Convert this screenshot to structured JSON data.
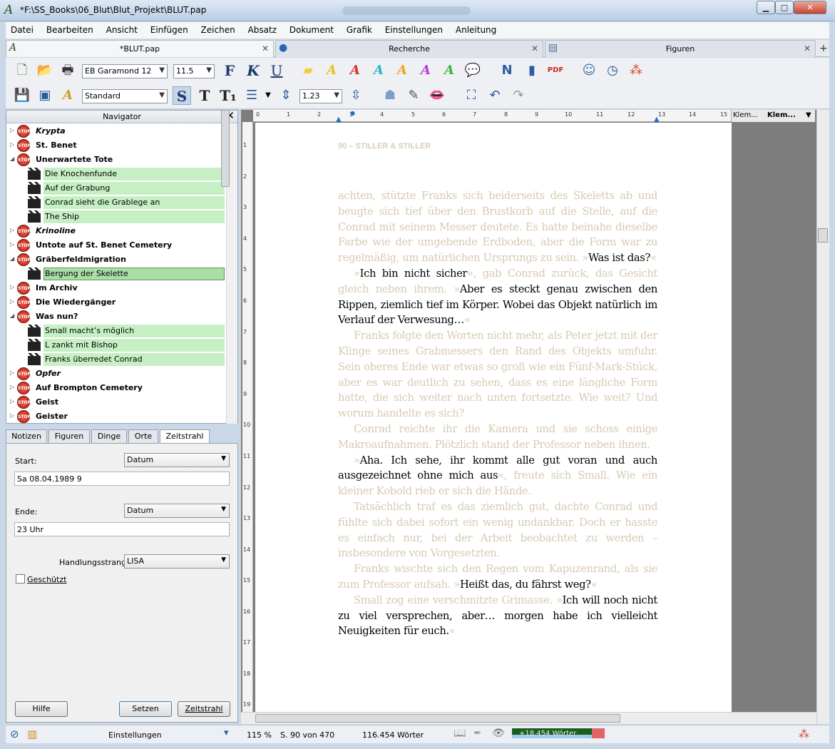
{
  "window": {
    "title": "*F:\\SS_Books\\06_Blut\\Blut_Projekt\\BLUT.pap",
    "buttons": {
      "minimize": "▁",
      "maximize": "□",
      "close": "✕"
    }
  },
  "menu": [
    "Datei",
    "Bearbeiten",
    "Ansicht",
    "Einfügen",
    "Zeichen",
    "Absatz",
    "Dokument",
    "Grafik",
    "Einstellungen",
    "Anleitung"
  ],
  "tabs": [
    {
      "label": "*BLUT.pap"
    },
    {
      "label": "Recherche"
    },
    {
      "label": "Figuren"
    }
  ],
  "toolbar": {
    "font": "EB Garamond 12",
    "size": "11.5",
    "style": "Standard",
    "line_spacing": "1.23",
    "bold": "F",
    "italic": "K",
    "underline": "U",
    "s_btn": "S",
    "t_btn": "T",
    "t1_btn": "T₁"
  },
  "navigator": {
    "title": "Navigator",
    "items": [
      {
        "label": "Krypta",
        "type": "chapter",
        "italic": true,
        "exp": "▷"
      },
      {
        "label": "St. Benet",
        "type": "chapter",
        "exp": "▷"
      },
      {
        "label": "Unerwartete Tote",
        "type": "chapter",
        "exp": "◢"
      },
      {
        "label": "Die Knochenfunde",
        "type": "scene"
      },
      {
        "label": "Auf der Grabung",
        "type": "scene"
      },
      {
        "label": "Conrad sieht die Grablege an",
        "type": "scene"
      },
      {
        "label": "The Ship",
        "type": "scene"
      },
      {
        "label": "Krinoline",
        "type": "chapter",
        "italic": true,
        "exp": "▷"
      },
      {
        "label": "Untote auf St. Benet Cemetery",
        "type": "chapter",
        "exp": "▷"
      },
      {
        "label": "Gräberfeldmigration",
        "type": "chapter",
        "exp": "◢"
      },
      {
        "label": "Bergung der Skelette",
        "type": "scene",
        "selected": true
      },
      {
        "label": "Im Archiv",
        "type": "chapter",
        "exp": "▷"
      },
      {
        "label": "Die Wiedergänger",
        "type": "chapter",
        "exp": "▷"
      },
      {
        "label": "Was nun?",
        "type": "chapter",
        "exp": "◢"
      },
      {
        "label": "Small macht’s möglich",
        "type": "scene"
      },
      {
        "label": "L zankt mit Bishop",
        "type": "scene"
      },
      {
        "label": "Franks überredet Conrad",
        "type": "scene"
      },
      {
        "label": "Opfer",
        "type": "chapter",
        "italic": true,
        "exp": "▷"
      },
      {
        "label": "Auf Brompton Cemetery",
        "type": "chapter",
        "exp": "▷"
      },
      {
        "label": "Geist",
        "type": "chapter",
        "exp": "▷"
      },
      {
        "label": "Geister",
        "type": "chapter",
        "exp": "▷"
      }
    ],
    "stop_text": "STOP"
  },
  "lower_tabs": [
    "Notizen",
    "Figuren",
    "Dinge",
    "Orte",
    "Zeitstrahl"
  ],
  "form": {
    "start_label": "Start:",
    "start_type": "Datum",
    "start_value": "Sa 08.04.1989 9",
    "end_label": "Ende:",
    "end_type": "Datum",
    "end_value": "23 Uhr",
    "strand_label": "Handlungsstrang:",
    "strand_value": "LISA",
    "protected_label": "Geschützt",
    "help_btn": "Hilfe",
    "set_btn": "Setzen",
    "timeline_btn": "Zeitstrahl"
  },
  "ruler": {
    "h_numbers": [
      "0",
      "1",
      "2",
      "3",
      "4",
      "5",
      "6",
      "7",
      "8",
      "9",
      "10",
      "11",
      "12",
      "13",
      "14",
      "15"
    ],
    "v_numbers": [
      "1",
      "2",
      "3",
      "4",
      "5",
      "6",
      "7",
      "8",
      "9",
      "10",
      "11",
      "12",
      "13",
      "14",
      "15",
      "16",
      "17",
      "18",
      "19"
    ],
    "end_left": "Klem...",
    "end_right": "Klem..."
  },
  "document": {
    "header": "90 – STILLER & STILLER",
    "paragraphs": [
      {
        "indent": false,
        "parts": [
          {
            "t": "achten, stützte Franks sich beiderseits des Skeletts ab und beugte sich tief über den Brustkorb auf die Stelle, auf die Conrad mit seinem Messer deutete. Es hatte beinahe dieselbe Farbe wie der umgebende Erdboden, aber die Form war zu regelmäßig, um natürlichen Ursprungs zu sein. »",
            "a": false
          },
          {
            "t": "Was ist das?",
            "a": true
          },
          {
            "t": "«",
            "a": false
          }
        ]
      },
      {
        "indent": true,
        "parts": [
          {
            "t": "»",
            "a": false
          },
          {
            "t": "Ich bin nicht sicher",
            "a": true
          },
          {
            "t": "«, gab Conrad zurück, das Gesicht gleich neben ihrem. »",
            "a": false
          },
          {
            "t": "Aber es steckt genau zwischen den Rippen, ziemlich tief im Körper. Wobei das Objekt natürlich im Verlauf der Verwesung…",
            "a": true
          },
          {
            "t": "«",
            "a": false
          }
        ]
      },
      {
        "indent": true,
        "parts": [
          {
            "t": "Franks folgte den Worten nicht mehr, als Peter jetzt mit der Klinge seines Grabmessers den Rand des Objekts umfuhr. Sein oberes Ende war etwas so groß wie ein Fünf-Mark-Stück, aber es war deutlich zu sehen, dass es eine längliche Form hatte, die sich weiter nach unten fortsetzte. Wie weit? Und worum handelte es sich?",
            "a": false
          }
        ]
      },
      {
        "indent": true,
        "parts": [
          {
            "t": "Conrad reichte ihr die Kamera und sie schoss einige Makroaufnahmen. Plötzlich stand der Professor neben ihnen.",
            "a": false
          }
        ]
      },
      {
        "indent": true,
        "parts": [
          {
            "t": "»",
            "a": false
          },
          {
            "t": "Aha. Ich sehe, ihr kommt alle gut voran und auch ausgezeichnet ohne mich aus",
            "a": true
          },
          {
            "t": "«, freute sich Small. Wie ein kleiner Kobold rieb er sich die Hände.",
            "a": false
          }
        ]
      },
      {
        "indent": true,
        "parts": [
          {
            "t": "Tatsächlich traf es das ziemlich gut, dachte Conrad und fühlte sich dabei sofort ein wenig undankbar. Doch er hasste es einfach nur, bei der Arbeit beobachtet zu werden – insbesondere von Vorgesetzten.",
            "a": false
          }
        ]
      },
      {
        "indent": true,
        "parts": [
          {
            "t": "Franks wischte sich den Regen vom Kapuzenrand, als sie zum Professor aufsah. »",
            "a": false
          },
          {
            "t": "Heißt das, du fährst weg?",
            "a": true
          },
          {
            "t": "«",
            "a": false
          }
        ]
      },
      {
        "indent": true,
        "parts": [
          {
            "t": "Small zog eine verschmitzte Grimasse. »",
            "a": false
          },
          {
            "t": "Ich will noch nicht zu viel versprechen, aber… morgen habe ich vielleicht Neuigkeiten für euch.",
            "a": true
          },
          {
            "t": "«",
            "a": false
          }
        ]
      }
    ]
  },
  "status": {
    "settings": "Einstellungen",
    "zoom": "115 %",
    "page": "S. 90 von 470",
    "words": "116.454 Wörter",
    "word_goal": "+18.454 Wörter"
  }
}
